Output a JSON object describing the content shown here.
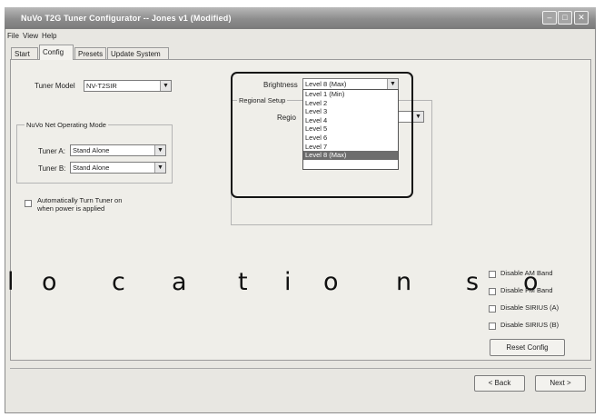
{
  "window": {
    "title": "NuVo T2G Tuner Configurator -- Jones v1 (Modified)"
  },
  "menu": [
    "File",
    "View",
    "Help"
  ],
  "tabs": [
    "Start",
    "Config",
    "Presets",
    "Update System"
  ],
  "config": {
    "tuner_model_label": "Tuner Model",
    "tuner_model_value": "NV-T2SIR",
    "operating_mode_title": "NuVo Net Operating Mode",
    "tuner_a_label": "Tuner A:",
    "tuner_a_value": "Stand Alone",
    "tuner_b_label": "Tuner B:",
    "tuner_b_value": "Stand Alone",
    "auto_on_label_line1": "Automatically Turn Tuner on",
    "auto_on_label_line2": "when power is applied",
    "brightness_label": "Brightness",
    "brightness_value": "Level 8 (Max)",
    "brightness_options": [
      "Level 1 (Min)",
      "Level 2",
      "Level 3",
      "Level 4",
      "Level 5",
      "Level 6",
      "Level 7",
      "Level 8 (Max)"
    ],
    "regional_setup_title": "Regional Setup",
    "region_label": "Regio",
    "disable_options": [
      "Disable AM Band",
      "Disable FM Band",
      "Disable SIRIUS (A)",
      "Disable SIRIUS (B)"
    ],
    "reset_label": "Reset Config"
  },
  "footer": {
    "back_label": "< Back",
    "next_label": "Next >"
  },
  "caption": [
    "l",
    "o",
    "c",
    "a",
    "t",
    "i",
    "o",
    "n",
    "s",
    "o"
  ]
}
